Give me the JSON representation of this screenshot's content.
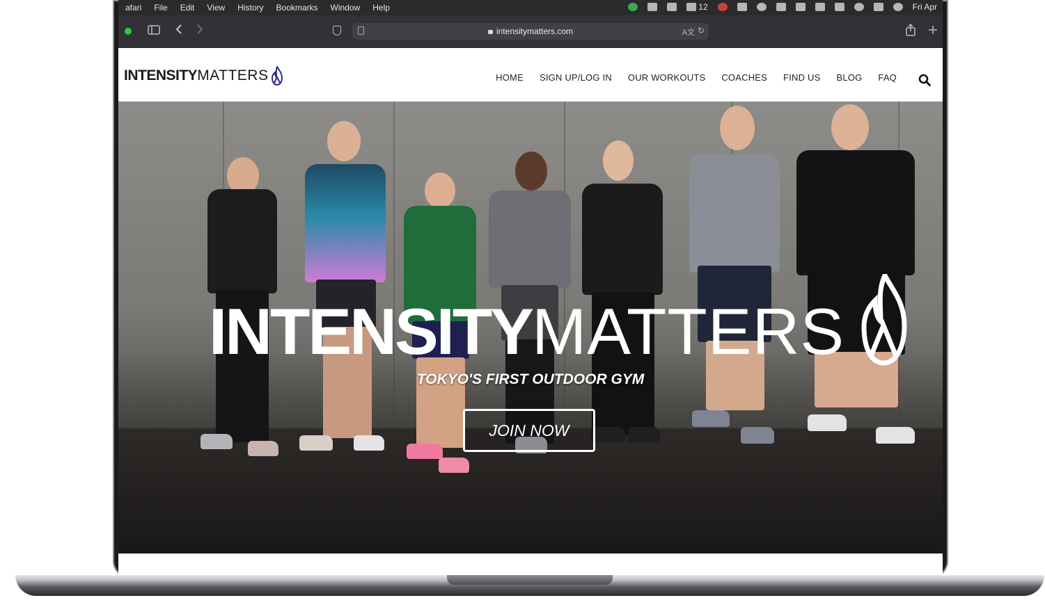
{
  "menubar": {
    "items": [
      "afari",
      "File",
      "Edit",
      "View",
      "History",
      "Bookmarks",
      "Window",
      "Help"
    ],
    "battery_count": "12",
    "clock": "Fri Apr"
  },
  "browser": {
    "url": "intensitymatters.com",
    "back_icon": "chevron-left-icon",
    "forward_icon": "chevron-right-icon",
    "share_icon": "share-icon",
    "new_tab_icon": "plus-icon"
  },
  "site": {
    "logo": {
      "bold": "INTENSITY",
      "light": "MATTERS"
    },
    "nav": [
      "HOME",
      "SIGN UP/LOG IN",
      "OUR WORKOUTS",
      "COACHES",
      "FIND US",
      "BLOG",
      "FAQ"
    ],
    "search_icon": "search-icon"
  },
  "hero": {
    "title_bold": "INTENSITY",
    "title_light": "MATTERS",
    "tagline": "TOKYO'S FIRST OUTDOOR GYM",
    "cta": "JOIN NOW"
  },
  "colors": {
    "accent": "#2b2a8c",
    "menubar": "#2b2b2e",
    "toolbar": "#323236"
  }
}
